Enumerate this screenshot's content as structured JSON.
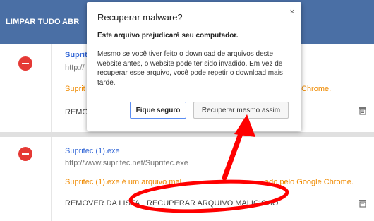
{
  "toolbar": {
    "clear_all": "LIMPAR TUDO",
    "open_folder_partial": "ABR"
  },
  "downloads": [
    {
      "name_partial": "Suprit",
      "url_partial": "http://",
      "warning_prefix": "Suprit",
      "warning_suffix": "Chrome.",
      "action_partial": "REMO"
    },
    {
      "name": "Supritec (1).exe",
      "url": "http://www.supritec.net/Supritec.exe",
      "warning": "Supritec (1).exe é um arquivo mal",
      "warning_suffix": "ado pelo Google Chrome.",
      "remove_label": "REMOVER DA LISTA",
      "recover_label": "RECUPERAR ARQUIVO MALICIOSO"
    }
  ],
  "dialog": {
    "title": "Recuperar malware?",
    "subtitle": "Este arquivo prejudicará seu computador.",
    "body": "Mesmo se você tiver feito o download de arquivos deste website antes, o website pode ter sido invadido. Em vez de recuperar esse arquivo, você pode repetir o download mais tarde.",
    "close_glyph": "×",
    "stay_safe_label": "Fique seguro",
    "recover_anyway_label": "Recuperar mesmo assim"
  },
  "colors": {
    "header_bg": "#4a6fa5",
    "link": "#3367d6",
    "warning": "#ef8a00",
    "error_icon": "#e53935",
    "annotation": "#ff0000"
  },
  "icons": {
    "error": "error-circle-icon",
    "delete": "trash-icon",
    "close": "close-icon"
  }
}
